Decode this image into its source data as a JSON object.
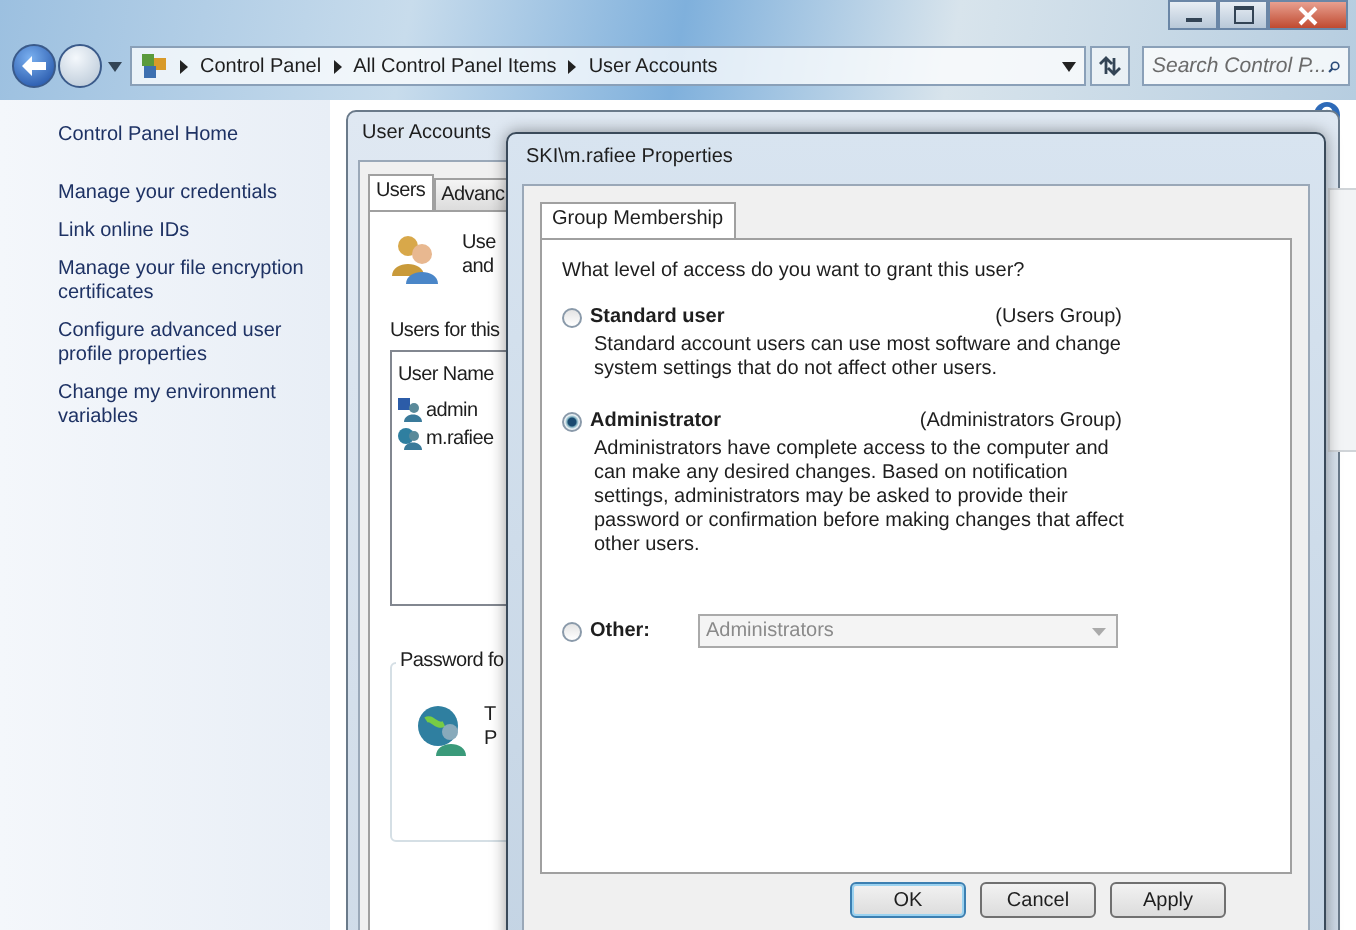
{
  "address_bar": {
    "breadcrumbs": [
      "Control Panel",
      "All Control Panel Items",
      "User Accounts"
    ]
  },
  "search": {
    "placeholder": "Search Control P..."
  },
  "sidebar": {
    "home": "Control Panel Home",
    "items": [
      "Manage your credentials",
      "Link online IDs",
      "Manage your file encryption certificates",
      "Configure advanced user profile properties",
      "Change my environment variables"
    ]
  },
  "user_accounts_dialog": {
    "title": "User Accounts",
    "tabs": [
      {
        "label": "Users",
        "selected": true
      },
      {
        "label": "Advanc",
        "selected": false
      }
    ],
    "intro_lines": [
      "Use",
      "and"
    ],
    "users_label": "Users for this",
    "list_column": "User Name",
    "users": [
      {
        "name": "admin",
        "kind": "admin"
      },
      {
        "name": "m.rafiee",
        "kind": "domain"
      }
    ],
    "password_group": {
      "title": "Password fo",
      "lines": [
        "T",
        "P"
      ]
    }
  },
  "properties_dialog": {
    "title": "SKI\\m.rafiee Properties",
    "tabs": [
      {
        "label": "Group Membership",
        "selected": true
      }
    ],
    "question": "What level of access do you want to grant this user?",
    "options": [
      {
        "kind": "described",
        "label": "Standard user",
        "group": "(Users Group)",
        "description": "Standard account users can use most software and change system settings that do not affect other users.",
        "selected": false
      },
      {
        "kind": "described",
        "label": "Administrator",
        "group": "(Administrators Group)",
        "description": "Administrators have complete access to the computer and can make any desired changes. Based on notification settings, administrators may be asked to provide their password or confirmation before making changes that affect other users.",
        "selected": true
      },
      {
        "kind": "dropdown",
        "label": "Other:",
        "value": "Administrators",
        "disabled": true,
        "selected": false
      }
    ],
    "buttons": [
      {
        "label": "OK",
        "default": true
      },
      {
        "label": "Cancel",
        "default": false
      },
      {
        "label": "Apply",
        "default": false
      }
    ]
  }
}
